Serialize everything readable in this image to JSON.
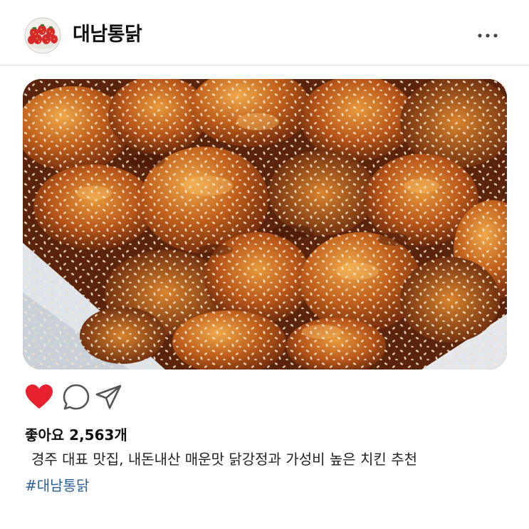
{
  "post": {
    "username": "대남통닭",
    "avatar_icon": "strawberry-avatar-icon",
    "more_icon": "more-dots-icon",
    "photo_description_icon": "fried-chicken-photo",
    "liked": true,
    "like_color": "#e8212e",
    "likes_text": "좋아요 2,563개",
    "caption": "경주 대표 맛집, 내돈내산 매운맛 닭강정과 가성비 높은 치킨 추천",
    "hashtag": "#대남통닭",
    "hashtag_color": "#2b5f95"
  }
}
